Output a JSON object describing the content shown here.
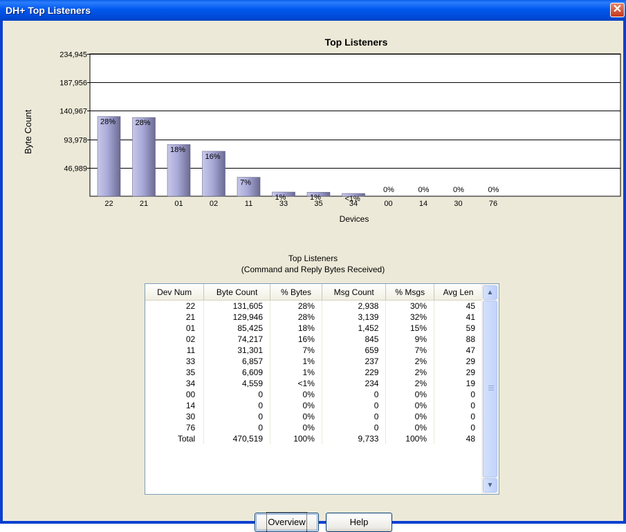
{
  "window": {
    "title": "DH+ Top Listeners",
    "close_glyph": "✕"
  },
  "chart_data": {
    "type": "bar",
    "title": "Top Listeners",
    "xlabel": "Devices",
    "ylabel": "Byte Count",
    "ylim": [
      0,
      234945
    ],
    "yticks": [
      "234,945",
      "187,956",
      "140,967",
      "93,978",
      "46,989"
    ],
    "ytick_values": [
      234945,
      187956,
      140967,
      93978,
      46989
    ],
    "categories": [
      "22",
      "21",
      "01",
      "02",
      "11",
      "33",
      "35",
      "34",
      "00",
      "14",
      "30",
      "76"
    ],
    "values": [
      131605,
      129946,
      85425,
      74217,
      31301,
      6857,
      6609,
      4559,
      0,
      0,
      0,
      0
    ],
    "labels": [
      "28%",
      "28%",
      "18%",
      "16%",
      "7%",
      "1%",
      "1%",
      "<1%",
      "0%",
      "0%",
      "0%",
      "0%"
    ],
    "grid": true,
    "bar_color": "#a9a9d8"
  },
  "table": {
    "title_line1": "Top Listeners",
    "title_line2": "(Command and Reply Bytes Received)",
    "columns": [
      "Dev Num",
      "Byte Count",
      "% Bytes",
      "Msg Count",
      "% Msgs",
      "Avg Len"
    ],
    "rows": [
      [
        "22",
        "131,605",
        "28%",
        "2,938",
        "30%",
        "45"
      ],
      [
        "21",
        "129,946",
        "28%",
        "3,139",
        "32%",
        "41"
      ],
      [
        "01",
        "85,425",
        "18%",
        "1,452",
        "15%",
        "59"
      ],
      [
        "02",
        "74,217",
        "16%",
        "845",
        "9%",
        "88"
      ],
      [
        "11",
        "31,301",
        "7%",
        "659",
        "7%",
        "47"
      ],
      [
        "33",
        "6,857",
        "1%",
        "237",
        "2%",
        "29"
      ],
      [
        "35",
        "6,609",
        "1%",
        "229",
        "2%",
        "29"
      ],
      [
        "34",
        "4,559",
        "<1%",
        "234",
        "2%",
        "19"
      ],
      [
        "00",
        "0",
        "0%",
        "0",
        "0%",
        "0"
      ],
      [
        "14",
        "0",
        "0%",
        "0",
        "0%",
        "0"
      ],
      [
        "30",
        "0",
        "0%",
        "0",
        "0%",
        "0"
      ],
      [
        "76",
        "0",
        "0%",
        "0",
        "0%",
        "0"
      ],
      [
        "Total",
        "470,519",
        "100%",
        "9,733",
        "100%",
        "48"
      ]
    ]
  },
  "buttons": {
    "overview": "Overview",
    "help": "Help"
  },
  "icons": {
    "scroll_up": "chevron-up-icon",
    "scroll_down": "chevron-down-icon"
  }
}
